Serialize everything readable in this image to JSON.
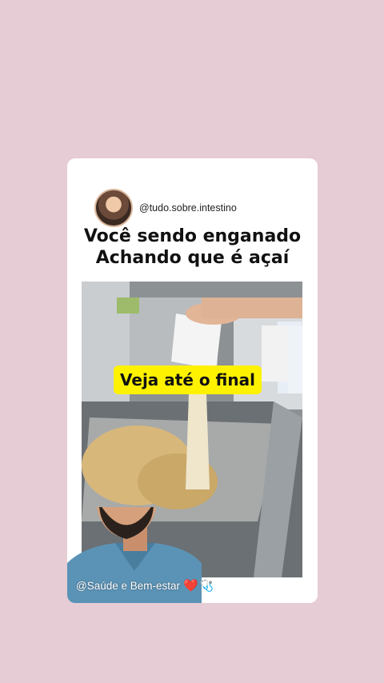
{
  "post": {
    "handle": "@tudo.sobre.intestino",
    "headline_line1": "Você sendo enganado",
    "headline_line2": "Achando que é açaí"
  },
  "video": {
    "overlay_text": "Veja até o final",
    "highlight_color": "#fff200"
  },
  "footer": {
    "caption": "@Saúde e Bem-estar",
    "heart_glyph": "❤️",
    "stethoscope_glyph": "🩺"
  },
  "colors": {
    "background": "#e6ccd4",
    "card": "#ffffff"
  }
}
